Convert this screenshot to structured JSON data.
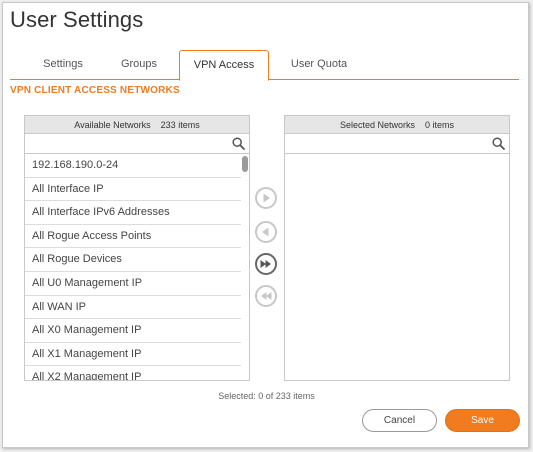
{
  "dialog": {
    "title": "User Settings"
  },
  "tabs": [
    {
      "label": "Settings",
      "active": false
    },
    {
      "label": "Groups",
      "active": false
    },
    {
      "label": "VPN Access",
      "active": true
    },
    {
      "label": "User Quota",
      "active": false
    }
  ],
  "section": {
    "heading": "VPN CLIENT ACCESS NETWORKS"
  },
  "available": {
    "title": "Available Networks",
    "count": "233 items",
    "search_value": "",
    "items": [
      "192.168.190.0-24",
      "All Interface IP",
      "All Interface IPv6 Addresses",
      "All Rogue Access Points",
      "All Rogue Devices",
      "All U0 Management IP",
      "All WAN IP",
      "All X0 Management IP",
      "All X1 Management IP",
      "All X2 Management IP"
    ]
  },
  "selected": {
    "title": "Selected Networks",
    "count": "0 items",
    "search_value": ""
  },
  "movers": [
    {
      "icon": "play-icon",
      "enabled": false
    },
    {
      "icon": "rewind-icon",
      "enabled": false
    },
    {
      "icon": "fast-forward-icon",
      "enabled": true
    },
    {
      "icon": "fast-rewind-icon",
      "enabled": false
    }
  ],
  "status": {
    "text": "Selected: 0 of 233 items"
  },
  "buttons": {
    "cancel": "Cancel",
    "save": "Save"
  },
  "colors": {
    "accent": "#f07c1f",
    "border": "#c8c8c8",
    "header_bg": "#e6e6e6"
  }
}
